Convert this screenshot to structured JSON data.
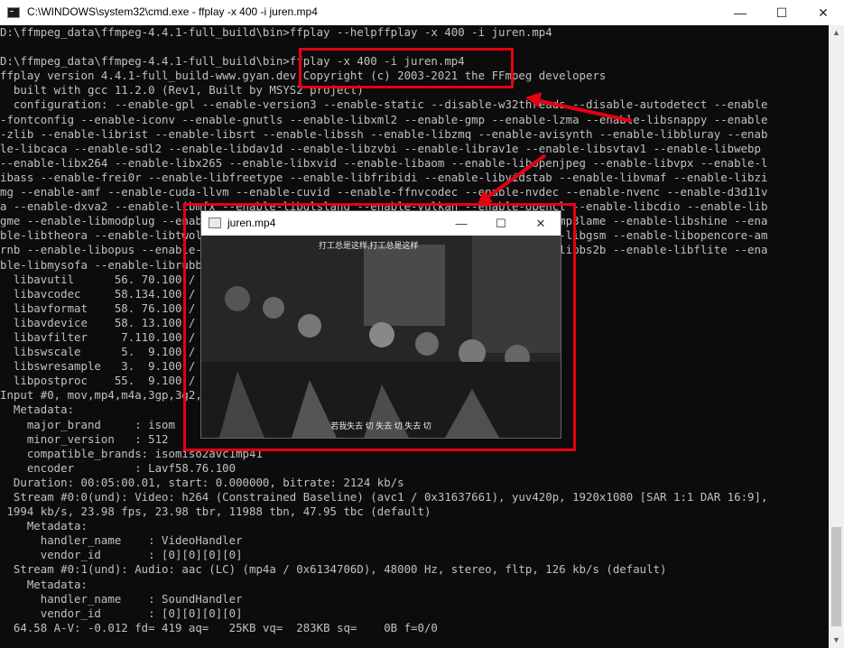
{
  "window": {
    "title": "C:\\WINDOWS\\system32\\cmd.exe - ffplay  -x 400 -i juren.mp4",
    "minimize": "—",
    "maximize": "☐",
    "close": "✕"
  },
  "console_lines": [
    "D:\\ffmpeg_data\\ffmpeg-4.4.1-full_build\\bin>ffplay --helpffplay -x 400 -i juren.mp4",
    "",
    "D:\\ffmpeg_data\\ffmpeg-4.4.1-full_build\\bin>ffplay -x 400 -i juren.mp4",
    "ffplay version 4.4.1-full_build-www.gyan.dev Copyright (c) 2003-2021 the FFmpeg developers",
    "  built with gcc 11.2.0 (Rev1, Built by MSYS2 project)",
    "  configuration: --enable-gpl --enable-version3 --enable-static --disable-w32threads --disable-autodetect --enable",
    "-fontconfig --enable-iconv --enable-gnutls --enable-libxml2 --enable-gmp --enable-lzma --enable-libsnappy --enable",
    "-zlib --enable-librist --enable-libsrt --enable-libssh --enable-libzmq --enable-avisynth --enable-libbluray --enab",
    "le-libcaca --enable-sdl2 --enable-libdav1d --enable-libzvbi --enable-librav1e --enable-libsvtav1 --enable-libwebp",
    "--enable-libx264 --enable-libx265 --enable-libxvid --enable-libaom --enable-libopenjpeg --enable-libvpx --enable-l",
    "ibass --enable-frei0r --enable-libfreetype --enable-libfribidi --enable-libvidstab --enable-libvmaf --enable-libzi",
    "mg --enable-amf --enable-cuda-llvm --enable-cuvid --enable-ffnvcodec --enable-nvdec --enable-nvenc --enable-d3d11v",
    "a --enable-dxva2 --enable-libmfx --enable-libglslang --enable-vulkan --enable-opencl --enable-libcdio --enable-lib",
    "gme --enable-libmodplug --enable-libopenmpt --enable-libopencore-amrwb --enable-libmp3lame --enable-libshine --ena",
    "ble-libtheora --enable-libtwolame --enable-libvo-amrwbenc --enable-libilbc --enable-libgsm --enable-libopencore-am",
    "rnb --enable-libopus --enable-libspeex --enable-libvorbis --enable-ladspa --enable-libbs2b --enable-libflite --ena",
    "ble-libmysofa --enable-librubberband --enable-libsoxr --enable-chromaprint",
    "  libavutil      56. 70.100 / 56. 70.100",
    "  libavcodec     58.134.100 / 58.134.100",
    "  libavformat    58. 76.100 / 58. 76.100",
    "  libavdevice    58. 13.100 / 58. 13.100",
    "  libavfilter     7.110.100 /  7.110.100",
    "  libswscale      5.  9.100 /  5.  9.100",
    "  libswresample   3.  9.100 /  3.  9.100",
    "  libpostproc    55.  9.100 / 55.  9.100",
    "Input #0, mov,mp4,m4a,3gp,3g2,mj2, from 'juren.mp4':",
    "  Metadata:",
    "    major_brand     : isom",
    "    minor_version   : 512",
    "    compatible_brands: isomiso2avc1mp41",
    "    encoder         : Lavf58.76.100",
    "  Duration: 00:05:00.01, start: 0.000000, bitrate: 2124 kb/s",
    "  Stream #0:0(und): Video: h264 (Constrained Baseline) (avc1 / 0x31637661), yuv420p, 1920x1080 [SAR 1:1 DAR 16:9],",
    " 1994 kb/s, 23.98 fps, 23.98 tbr, 11988 tbn, 47.95 tbc (default)",
    "    Metadata:",
    "      handler_name    : VideoHandler",
    "      vendor_id       : [0][0][0][0]",
    "  Stream #0:1(und): Audio: aac (LC) (mp4a / 0x6134706D), 48000 Hz, stereo, fltp, 126 kb/s (default)",
    "    Metadata:",
    "      handler_name    : SoundHandler",
    "      vendor_id       : [0][0][0][0]",
    "  64.58 A-V: -0.012 fd= 419 aq=   25KB vq=  283KB sq=    0B f=0/0"
  ],
  "ffplay_window": {
    "title": "juren.mp4",
    "minimize": "—",
    "maximize": "☐",
    "close": "✕",
    "subtitle_top": "打工总是这样,打工总是这样",
    "subtitle_bottom": "若我失去  切  失去  切  失去  切"
  },
  "scrollbar": {
    "up": "▲",
    "down": "▼"
  },
  "colors": {
    "highlight": "#e60012",
    "console_bg": "#0c0c0c",
    "console_text": "#c0c0c0"
  }
}
